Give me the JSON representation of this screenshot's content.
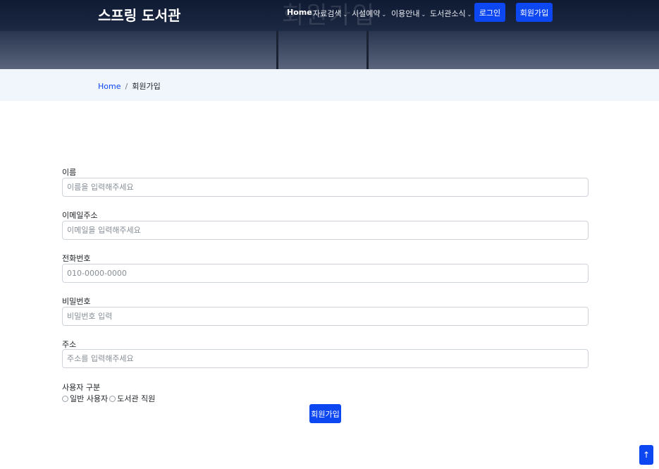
{
  "header": {
    "brand": "스프링 도서관",
    "ghost_title": "회원가입",
    "nav": [
      {
        "label": "Home",
        "chevron": ""
      },
      {
        "label": "자료검색",
        "chevron": "⌄"
      },
      {
        "label": "시설예약",
        "chevron": "⌄"
      },
      {
        "label": "이용안내",
        "chevron": "⌄"
      },
      {
        "label": "도서관소식",
        "chevron": "⌄"
      }
    ],
    "login_label": "로그인",
    "signup_label": "회원가입"
  },
  "breadcrumb": {
    "home": "Home",
    "separator": "/",
    "current": "회원가입"
  },
  "form": {
    "fields": [
      {
        "label": "이름",
        "placeholder": "이름을 입력해주세요",
        "value": ""
      },
      {
        "label": "이메일주소",
        "placeholder": "이메일을 입력해주세요",
        "value": ""
      },
      {
        "label": "전화번호",
        "placeholder": "010-0000-0000",
        "value": ""
      },
      {
        "label": "비밀번호",
        "placeholder": "비밀번호 입력",
        "value": ""
      },
      {
        "label": "주소",
        "placeholder": "주소를 입력해주세요",
        "value": ""
      }
    ],
    "user_type_label": "사용자 구분",
    "user_types": [
      "일반 사용자",
      "도서관 직원"
    ],
    "submit_label": "회원가입"
  },
  "scroll_top_icon": "arrow-up-icon",
  "colors": {
    "primary": "#0d47f2",
    "breadcrumb_bg": "#f1f5fc",
    "header_bg": "#0f1a33"
  }
}
